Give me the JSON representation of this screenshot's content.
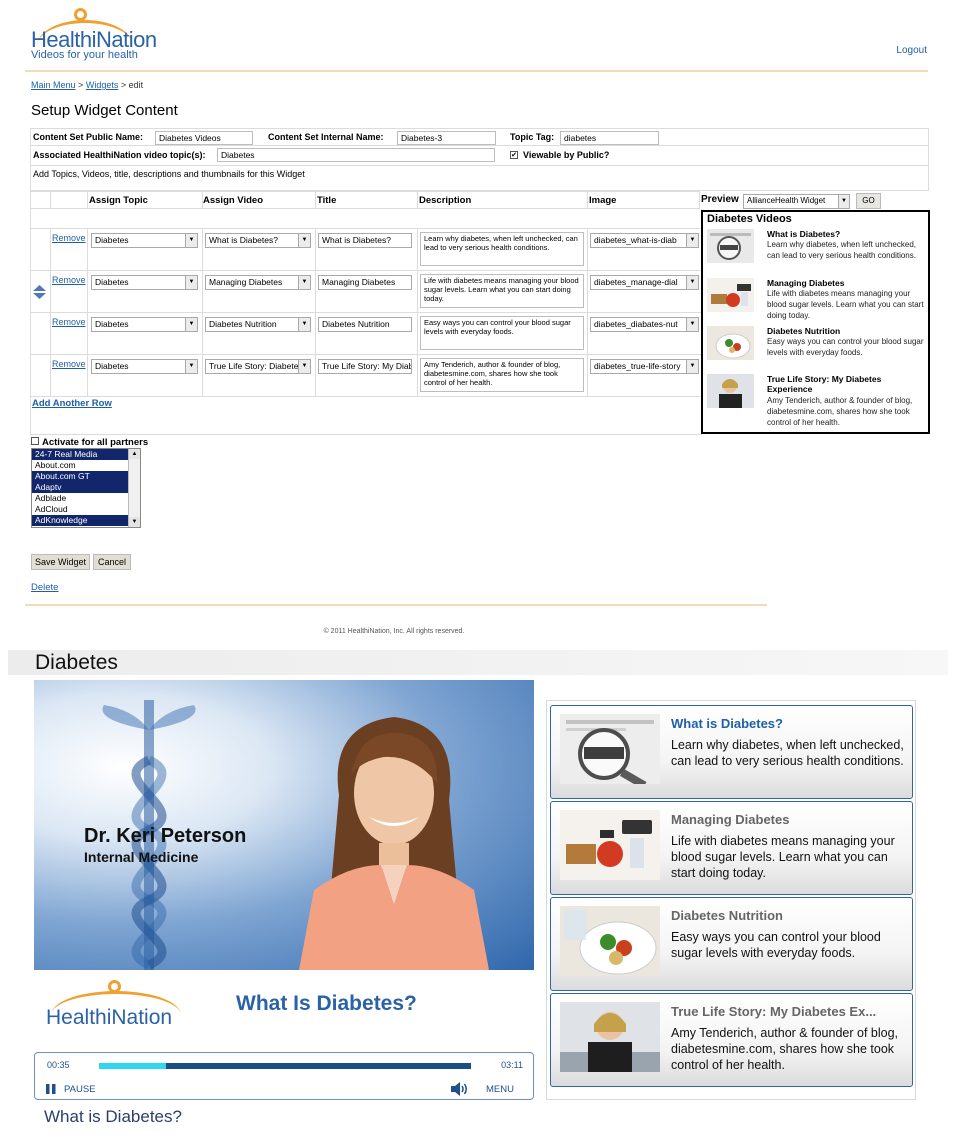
{
  "header": {
    "logo_name": "HealthiNation",
    "logo_tagline": "Videos for your health",
    "logout_label": "Logout"
  },
  "breadcrumb": {
    "main_menu": "Main Menu",
    "sep1": ">",
    "widgets": "Widgets",
    "sep2": "> edit"
  },
  "page_title": "Setup Widget Content",
  "form": {
    "public_name_label": "Content Set Public Name:",
    "public_name_value": "Diabetes Videos",
    "internal_name_label": "Content Set Internal Name:",
    "internal_name_value": "Diabetes-3",
    "topic_tag_label": "Topic Tag:",
    "topic_tag_value": "diabetes",
    "assoc_label": "Associated HealthiNation video topic(s):",
    "assoc_value": "Diabetes",
    "viewable_label": "Viewable by Public?",
    "viewable_checked": true,
    "instructions": "Add Topics, Videos, title, descriptions and thumbnails for this Widget"
  },
  "grid": {
    "headers": {
      "assign_topic": "Assign Topic",
      "assign_video": "Assign Video",
      "title": "Title",
      "description": "Description",
      "image": "Image"
    },
    "remove_label": "Remove",
    "rows": [
      {
        "topic": "Diabetes",
        "video": "What is Diabetes?",
        "title": "What is Diabetes?",
        "description": "Learn why diabetes, when left unchecked, can lead to very serious health conditions.",
        "image": "diabetes_what-is-diab"
      },
      {
        "topic": "Diabetes",
        "video": "Managing Diabetes",
        "title": "Managing Diabetes",
        "description": "Life with diabetes means managing your blood sugar levels. Learn what you can start doing today.",
        "image": "diabetes_manage-dial"
      },
      {
        "topic": "Diabetes",
        "video": "Diabetes Nutrition",
        "title": "Diabetes Nutrition",
        "description": "Easy ways you can control your blood sugar levels with everyday foods.",
        "image": "diabetes_diabates-nut"
      },
      {
        "topic": "Diabetes",
        "video": "True Life Story: Diabete",
        "title": "True Life Story: My Diab",
        "description": "Amy Tenderich, author & founder of blog, diabetesmine.com, shares how she took control of her health.",
        "image": "diabetes_true-life-story"
      }
    ],
    "add_row_label": "Add Another Row"
  },
  "preview": {
    "label": "Preview",
    "select_value": "AllianceHealth Widget",
    "go_label": "GO",
    "widget_title": "Diabetes Videos",
    "items": [
      {
        "title": "What is Diabetes?",
        "desc": "Learn why diabetes, when left unchecked, can lead to very serious health conditions."
      },
      {
        "title": "Managing Diabetes",
        "desc": "Life with diabetes means managing your blood sugar levels. Learn what you can start doing today."
      },
      {
        "title": "Diabetes Nutrition",
        "desc": "Easy ways you can control your blood sugar levels with everyday foods."
      },
      {
        "title": "True Life Story: My Diabetes Experience",
        "desc": "Amy Tenderich, author & founder of blog, diabetesmine.com, shares how she took control of her health."
      }
    ]
  },
  "partners": {
    "label": "Activate for all partners",
    "options": [
      {
        "name": "24-7 Real Media",
        "selected": true
      },
      {
        "name": "About.com",
        "selected": false
      },
      {
        "name": "About.com GT",
        "selected": true
      },
      {
        "name": "Adaptv",
        "selected": true
      },
      {
        "name": "Adblade",
        "selected": false
      },
      {
        "name": "AdCloud",
        "selected": false
      },
      {
        "name": "AdKnowledge",
        "selected": true
      }
    ]
  },
  "actions": {
    "save_label": "Save Widget",
    "cancel_label": "Cancel",
    "delete_label": "Delete"
  },
  "footer": {
    "copyright": "© 2011 HealthiNation, Inc. All rights reserved."
  },
  "player_page": {
    "title": "Diabetes",
    "presenter_name": "Dr. Keri Peterson",
    "presenter_role": "Internal Medicine",
    "brand": "HealthiNation",
    "video_heading": "What Is Diabetes?",
    "time_current": "00:35",
    "time_total": "03:11",
    "progress": 0.18,
    "pause_label": "PAUSE",
    "menu_label": "MENU",
    "caption": "What is Diabetes?",
    "playlist": [
      {
        "title": "What is Diabetes?",
        "desc": "Learn why diabetes, when left unchecked, can lead to very serious health conditions.",
        "active": true
      },
      {
        "title": "Managing Diabetes",
        "desc": "Life with diabetes means managing your blood sugar levels. Learn what you can start doing today.",
        "active": false
      },
      {
        "title": "Diabetes Nutrition",
        "desc": "Easy ways you can control your blood sugar levels with everyday foods.",
        "active": false
      },
      {
        "title": "True Life Story: My Diabetes Ex...",
        "desc": "Amy Tenderich, author & founder of blog, diabetesmine.com, shares how she took control of her health.",
        "active": false
      }
    ]
  }
}
